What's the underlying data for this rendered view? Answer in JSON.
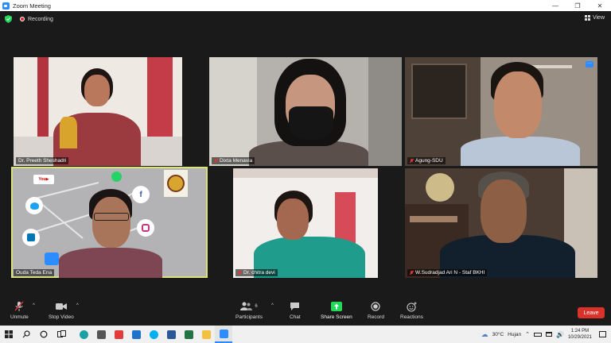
{
  "window": {
    "title": "Zoom Meeting"
  },
  "topbar": {
    "recording_label": "Recording",
    "view_label": "View"
  },
  "participants": [
    {
      "name": "Dr. Preeth Sheshadri",
      "muted": false
    },
    {
      "name": "Dixta Menavia",
      "muted": true
    },
    {
      "name": "Agung-SDU",
      "muted": true
    },
    {
      "name": "Ouda Teda Ena",
      "muted": false
    },
    {
      "name": "Dr. chitra devi",
      "muted": true
    },
    {
      "name": "W.Sudradjad Ari N - Staf BKHI",
      "muted": true
    }
  ],
  "toolbar": {
    "unmute": "Unmute",
    "stop_video": "Stop Video",
    "participants": "Participants",
    "participants_count": "6",
    "chat": "Chat",
    "share_screen": "Share Screen",
    "record": "Record",
    "reactions": "Reactions",
    "leave": "Leave"
  },
  "taskbar": {
    "temperature": "30°C",
    "weather": "Hujan",
    "time": "1:24 PM",
    "date": "10/29/2021"
  },
  "colors": {
    "zoom_blue": "#2d8cff",
    "share_green": "#23d959",
    "leave_red": "#d9322b",
    "active_speaker": "#d9e27a"
  }
}
